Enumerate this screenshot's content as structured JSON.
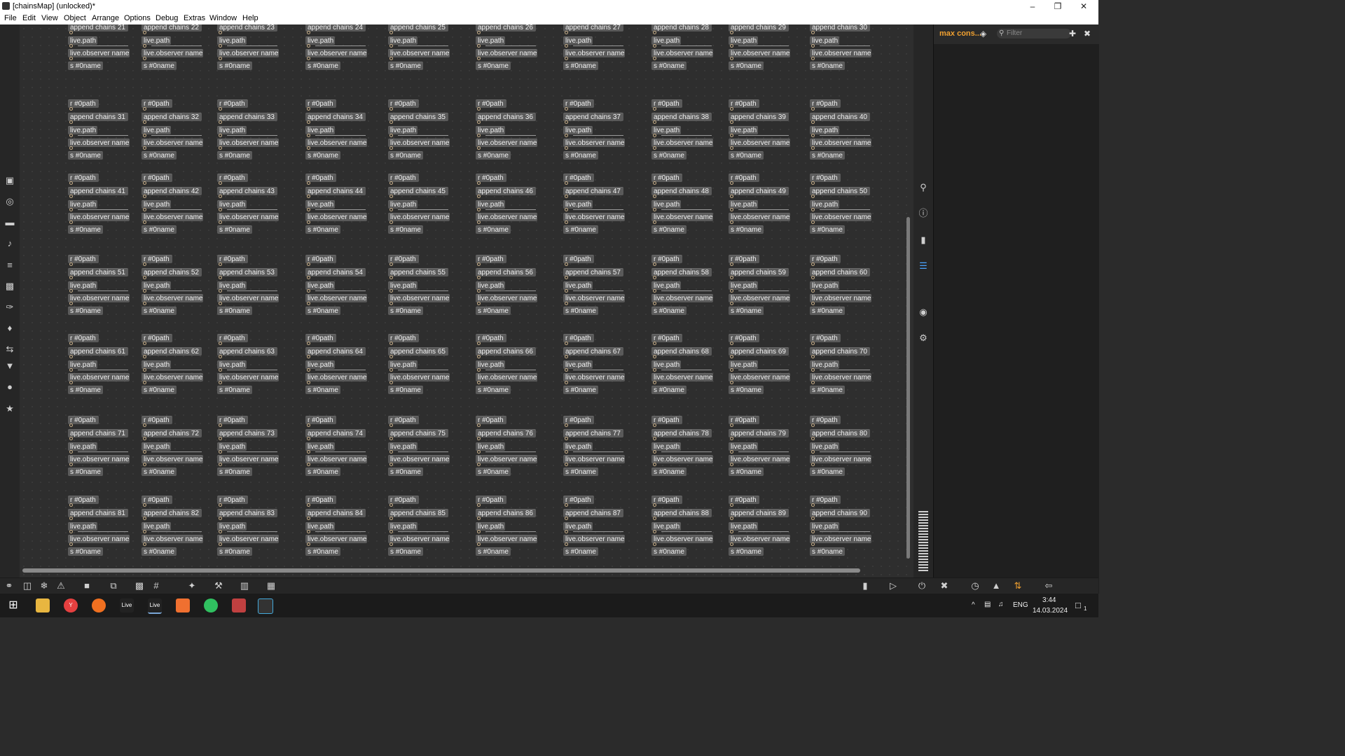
{
  "window": {
    "title": "[chainsMap] (unlocked)*",
    "controls": [
      "minimize",
      "restore",
      "close"
    ]
  },
  "menu": [
    "File",
    "Edit",
    "View",
    "Object",
    "Arrange",
    "Options",
    "Debug",
    "Extras",
    "Window",
    "Help"
  ],
  "patcher": {
    "receive_label": "r #0path",
    "append_prefix": "append chains",
    "path_label": "live.path",
    "observer_label": "live.observer name",
    "send_label": "s #0name",
    "blocks": [
      {
        "row": 0,
        "chain_start": 21,
        "has_receive": false
      },
      {
        "row": 1,
        "chain_start": 31,
        "has_receive": true
      },
      {
        "row": 2,
        "chain_start": 41,
        "has_receive": true
      },
      {
        "row": 3,
        "chain_start": 51,
        "has_receive": true
      },
      {
        "row": 4,
        "chain_start": 61,
        "has_receive": true
      },
      {
        "row": 5,
        "chain_start": 71,
        "has_receive": true
      },
      {
        "row": 6,
        "chain_start": 81,
        "has_receive": true
      }
    ],
    "columns_per_row": 10
  },
  "console": {
    "title": "max cons...",
    "filter_placeholder": "Filter"
  },
  "left_sidebar_icons": [
    "cube-icon",
    "target-icon",
    "keyboard-icon",
    "note-icon",
    "sequence-icon",
    "image-icon",
    "paperclip-icon",
    "puzzle-icon",
    "plugin-icon",
    "v-icon",
    "italic-icon",
    "star-icon"
  ],
  "right_sidebar_icons": [
    "search-icon",
    "info-icon",
    "book-icon",
    "list-icon",
    "camera-icon",
    "sliders-icon"
  ],
  "bottom_toolbar_icons": [
    "lock-icon",
    "presentation-icon",
    "snowflake-icon",
    "warning-icon",
    "comment-icon",
    "window-icon",
    "gripper-icon",
    "grid-icon",
    "wand-icon",
    "wrench-icon",
    "bars-icon",
    "keyboard-grid-icon"
  ],
  "bottom_right_icons": [
    "level-icon",
    "play-icon",
    "power-icon",
    "clear-icon",
    "clock-icon",
    "alert-icon",
    "scroll-icon",
    "back-icon"
  ],
  "taskbar": {
    "apps": [
      "windows-start",
      "file-explorer",
      "yandex-browser",
      "firefox",
      "live-1",
      "live-2",
      "orange-app",
      "green-app",
      "tiles-app",
      "terminal-app"
    ],
    "app_labels": {
      "live_1": "Live",
      "live_2": "Live"
    },
    "lang": "ENG",
    "time": "3:44",
    "date": "14.03.2024",
    "notification_count": "1"
  }
}
